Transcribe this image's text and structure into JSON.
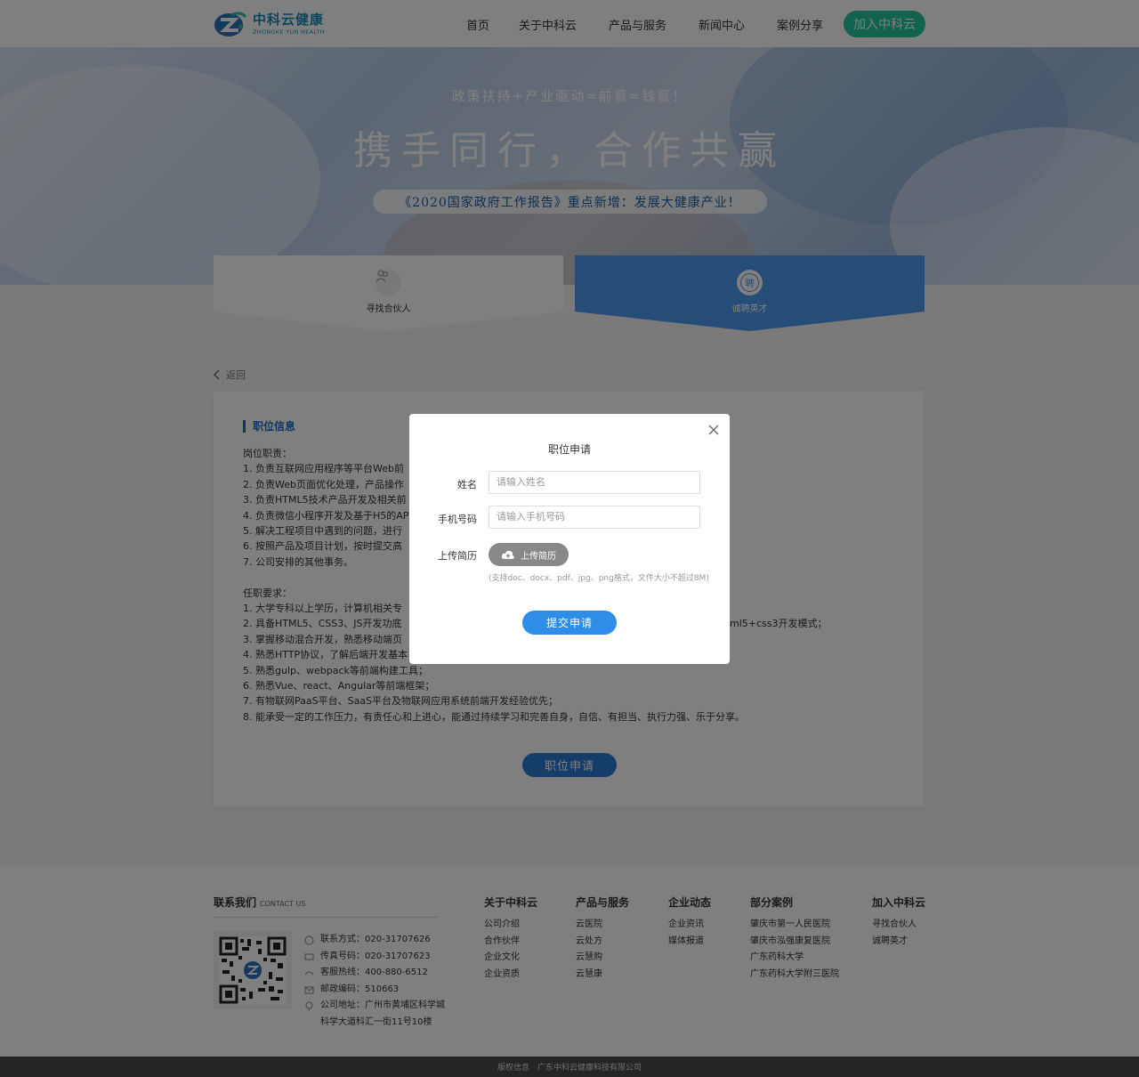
{
  "header": {
    "logo_cn": "中科云健康",
    "logo_en": "ZHONGKE YUN HEALTH",
    "nav": [
      "首页",
      "关于中科云",
      "产品与服务",
      "新闻中心",
      "案例分享"
    ],
    "join": "加入中科云",
    "join_color": "#26c59a"
  },
  "hero": {
    "subtitle": "政策扶持+产业驱动=前景=钱景！",
    "title": "携手同行，合作共赢",
    "pill": "《2020国家政府工作报告》重点新增：发展大健康产业！"
  },
  "tabs": [
    {
      "label": "寻找合伙人",
      "icon": "partners-icon",
      "active": false
    },
    {
      "label": "诚聘英才",
      "icon": "recruit-icon",
      "icon_text": "聘",
      "active": true
    }
  ],
  "back": "返回",
  "job": {
    "section_title": "职位信息",
    "duties_title": "岗位职责：",
    "duties": [
      "1. 负责互联网应用程序等平台Web前",
      "2. 负责Web页面优化处理，产品操作",
      "3. 负责HTML5技术产品开发及相关前",
      "4. 负责微信小程序开发及基于H5的AP",
      "5. 解决工程项目中遇到的问题，进行",
      "6. 按照产品及项目计划，按时提交高",
      "7. 公司安排的其他事务。"
    ],
    "req_title": "任职要求：",
    "requirements": [
      "1. 大学专科以上学历，计算机相关专",
      "2. 具备HTML5、CSS3、JS开发功底",
      "3. 掌握移动混合开发，熟悉移动端页",
      "4. 熟悉HTTP协议，了解后端开发基本",
      "5. 熟悉gulp、webpack等前端构建工具；",
      "6. 熟悉Vue、react、Angular等前端框架；",
      "7. 有物联网PaaS平台、SaaS平台及物联网应用系统前端开发经验优先；",
      "8. 能承受一定的工作压力，有责任心和上进心，能通过持续学习和完善自身，自信、有担当、执行力强、乐于分享。"
    ],
    "req2_tail": "ml5+css3开发模式；",
    "apply": "职位申请"
  },
  "modal": {
    "title": "职位申请",
    "name_label": "姓名",
    "name_placeholder": "请输入姓名",
    "phone_label": "手机号码",
    "phone_placeholder": "请输入手机号码",
    "upload_label": "上传简历",
    "upload_button": "上传简历",
    "upload_hint": "(支持doc、docx、pdf、jpg、png格式，文件大小不超过8M)",
    "submit": "提交申请"
  },
  "footer": {
    "contact_title": "联系我们",
    "contact_en": "CONTACT US",
    "phone": "联系方式：020-31707626",
    "fax": "传真号码：020-31707623",
    "hotline": "客服热线：400-880-6512",
    "postcode": "邮政编码：510663",
    "address1": "公司地址：广州市黄埔区科学城",
    "address2": "科学大道科汇一街11号10楼",
    "columns": [
      {
        "title": "关于中科云",
        "items": [
          "公司介绍",
          "合作伙伴",
          "企业文化",
          "企业资质"
        ]
      },
      {
        "title": "产品与服务",
        "items": [
          "云医院",
          "云处方",
          "云慧购",
          "云慧康"
        ]
      },
      {
        "title": "企业动态",
        "items": [
          "企业资讯",
          "媒体报道"
        ]
      },
      {
        "title": "部分案例",
        "items": [
          "肇庆市第一人民医院",
          "肇庆市泓强康复医院",
          "广东药科大学",
          "广东药科大学附三医院"
        ]
      },
      {
        "title": "加入中科云",
        "items": [
          "寻找合伙人",
          "诚聘英才"
        ]
      }
    ],
    "copyright": "版权信息　广东中科云健康科技有限公司"
  }
}
